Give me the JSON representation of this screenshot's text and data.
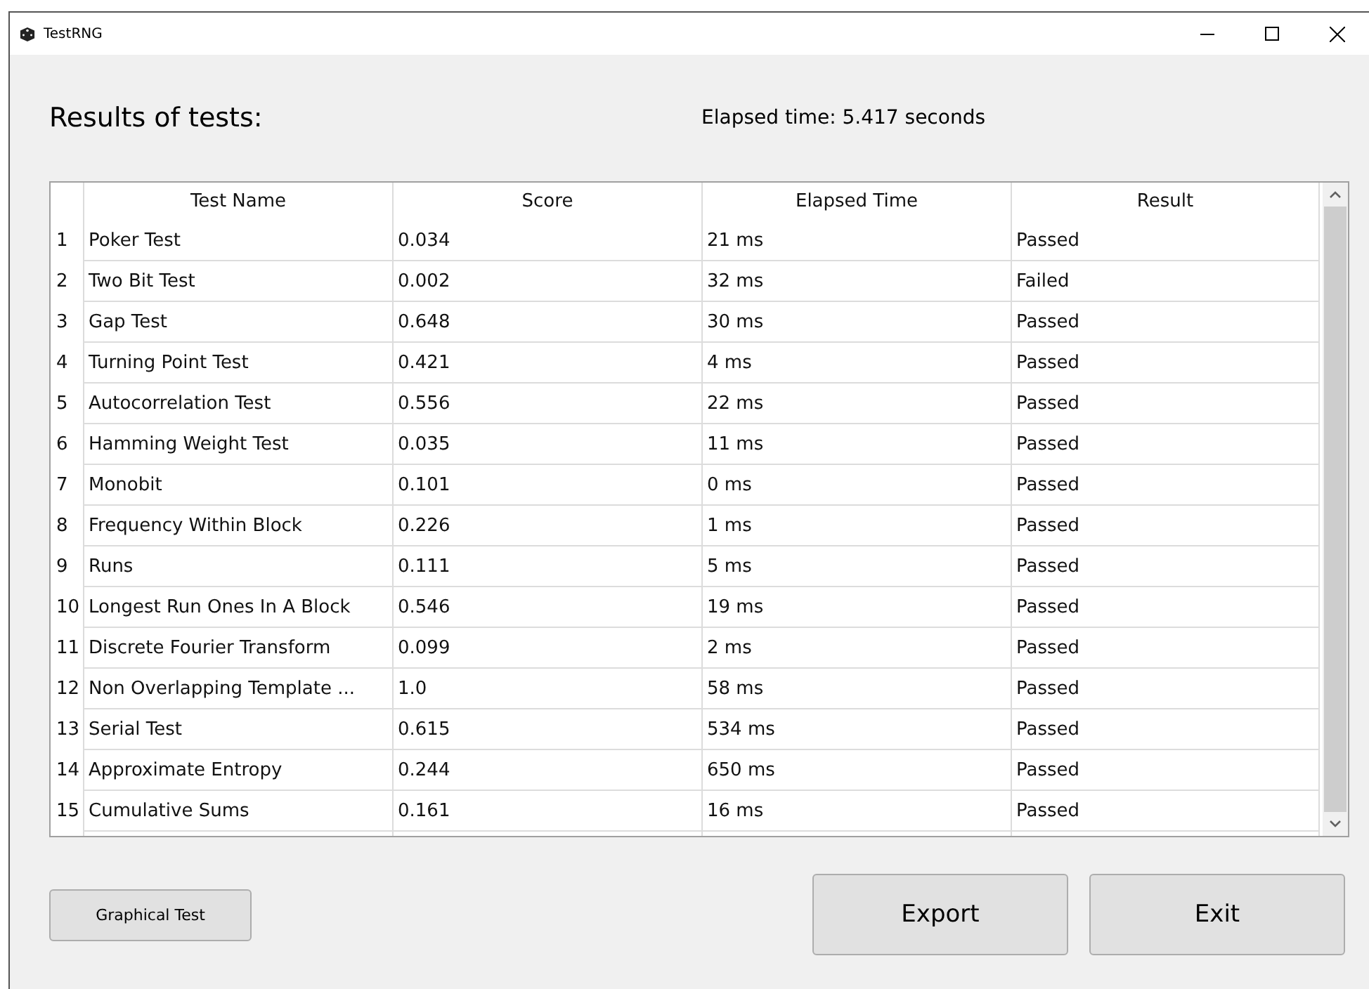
{
  "window": {
    "title": "TestRNG"
  },
  "heading": "Results of tests:",
  "elapsed": "Elapsed time: 5.417 seconds",
  "table": {
    "columns": [
      "Test Name",
      "Score",
      "Elapsed Time",
      "Result"
    ],
    "rows": [
      {
        "number": "1",
        "cells": [
          "Poker Test",
          "0.034",
          "21 ms",
          "Passed"
        ]
      },
      {
        "number": "2",
        "cells": [
          "Two Bit Test",
          "0.002",
          "32 ms",
          "Failed"
        ]
      },
      {
        "number": "3",
        "cells": [
          "Gap Test",
          "0.648",
          "30 ms",
          "Passed"
        ]
      },
      {
        "number": "4",
        "cells": [
          "Turning Point Test",
          "0.421",
          "4 ms",
          "Passed"
        ]
      },
      {
        "number": "5",
        "cells": [
          "Autocorrelation Test",
          "0.556",
          "22 ms",
          "Passed"
        ]
      },
      {
        "number": "6",
        "cells": [
          "Hamming Weight Test",
          "0.035",
          "11 ms",
          "Passed"
        ]
      },
      {
        "number": "7",
        "cells": [
          "Monobit",
          "0.101",
          "0 ms",
          "Passed"
        ]
      },
      {
        "number": "8",
        "cells": [
          "Frequency Within Block",
          "0.226",
          "1 ms",
          "Passed"
        ]
      },
      {
        "number": "9",
        "cells": [
          "Runs",
          "0.111",
          "5 ms",
          "Passed"
        ]
      },
      {
        "number": "10",
        "cells": [
          "Longest Run Ones In A Block",
          "0.546",
          "19 ms",
          "Passed"
        ]
      },
      {
        "number": "11",
        "cells": [
          "Discrete Fourier Transform",
          "0.099",
          "2 ms",
          "Passed"
        ]
      },
      {
        "number": "12",
        "cells": [
          "Non Overlapping Template ...",
          "1.0",
          "58 ms",
          "Passed"
        ]
      },
      {
        "number": "13",
        "cells": [
          "Serial Test",
          "0.615",
          "534 ms",
          "Passed"
        ]
      },
      {
        "number": "14",
        "cells": [
          "Approximate Entropy",
          "0.244",
          "650 ms",
          "Passed"
        ]
      },
      {
        "number": "15",
        "cells": [
          "Cumulative Sums",
          "0.161",
          "16 ms",
          "Passed"
        ]
      }
    ]
  },
  "buttons": {
    "graphical": "Graphical Test",
    "export": "Export",
    "exit": "Exit"
  }
}
